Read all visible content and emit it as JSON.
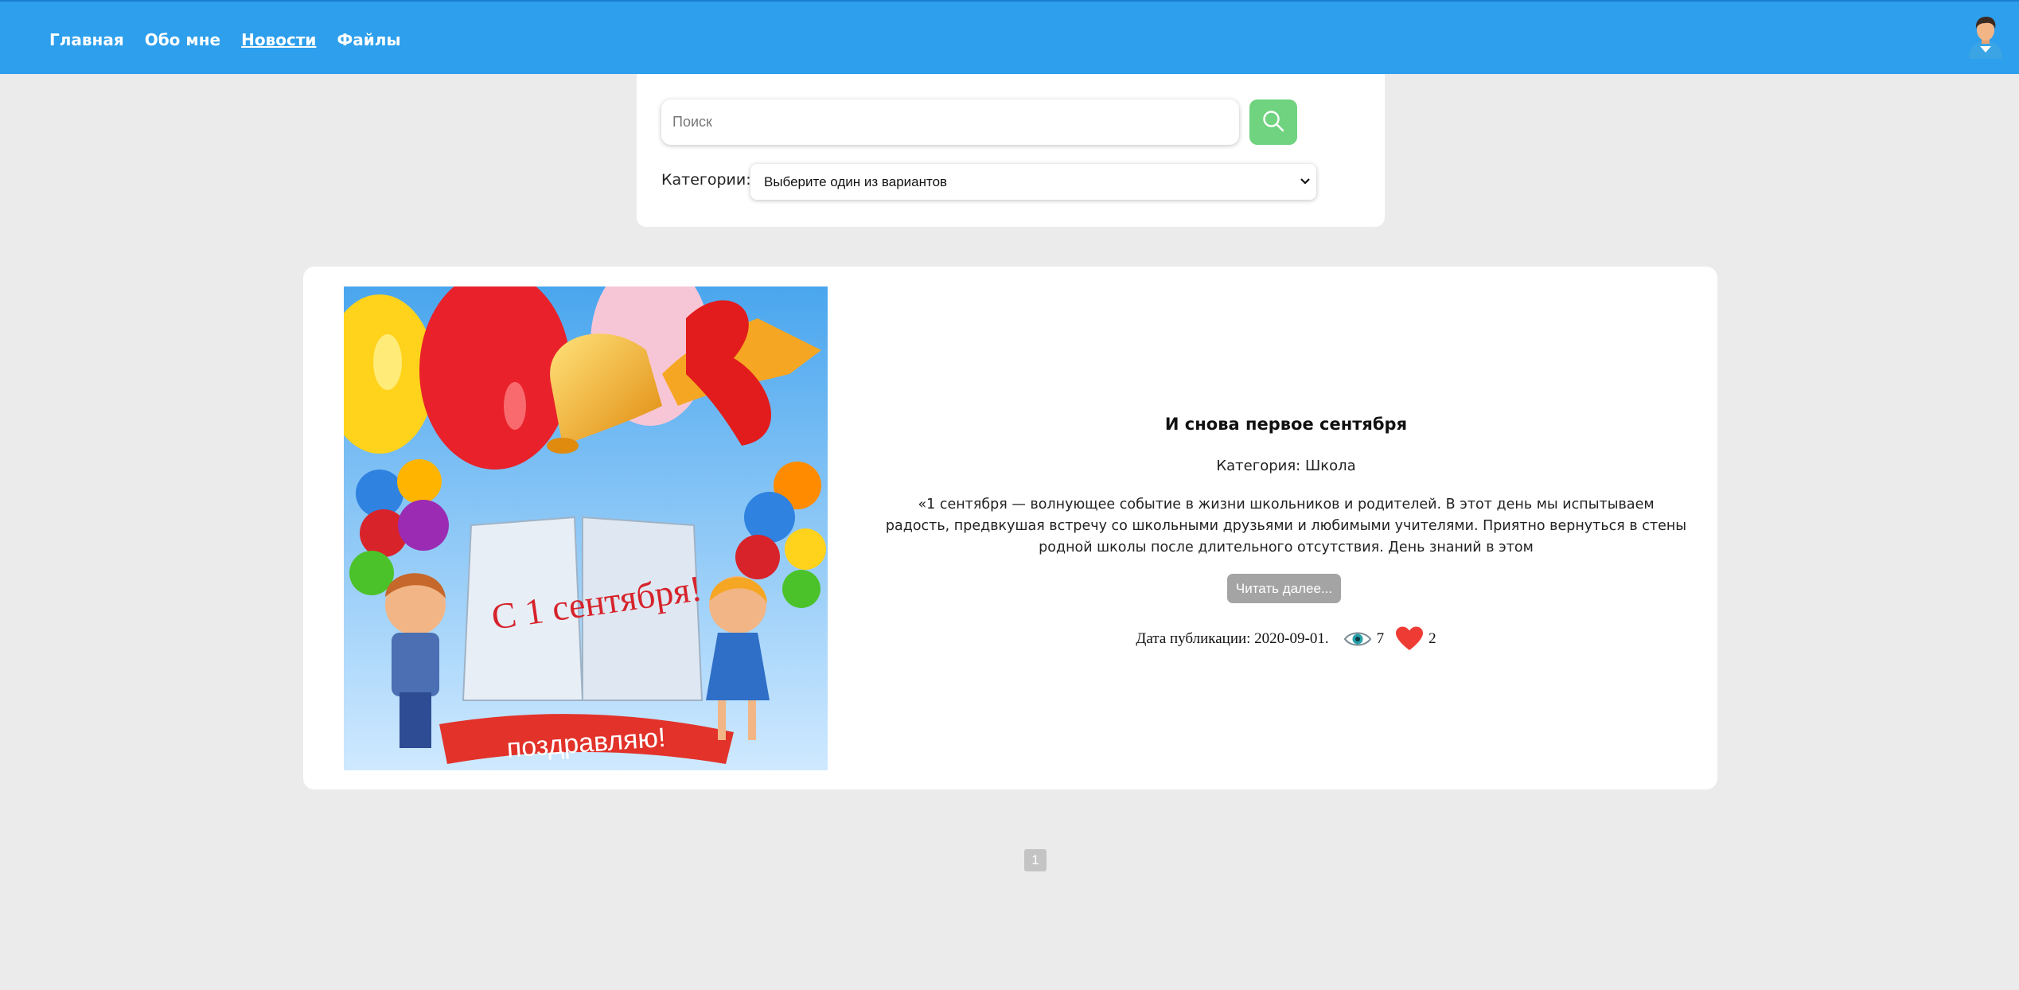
{
  "nav": {
    "items": [
      {
        "label": "Главная",
        "active": false
      },
      {
        "label": "Обо мне",
        "active": false
      },
      {
        "label": "Новости",
        "active": true
      },
      {
        "label": "Файлы",
        "active": false
      }
    ]
  },
  "search": {
    "placeholder": "Поиск",
    "button_icon": "search-icon"
  },
  "filter": {
    "label": "Категории:",
    "selected": "Выберите один из вариантов"
  },
  "news": {
    "image_text_1": "С 1 сентября!",
    "image_text_2": "поздравляю!",
    "title": "И снова первое сентября",
    "category": "Категория: Школа",
    "excerpt": "«1 сентября — волнующее событие в жизни школьников и родителей. В этот день мы испытываем радость, предвкушая встречу со школьными друзьями и любимыми учителями. Приятно вернуться в стены родной школы после длительного отсутствия. День знаний в этом",
    "read_more": "Читать далее...",
    "date": "Дата публикации: 2020-09-01.",
    "views": "7",
    "likes": "2"
  },
  "pagination": {
    "current": "1"
  },
  "colors": {
    "header": "#2d9fec",
    "search_button": "#6fd37f",
    "like_heart": "#ee3b34"
  }
}
